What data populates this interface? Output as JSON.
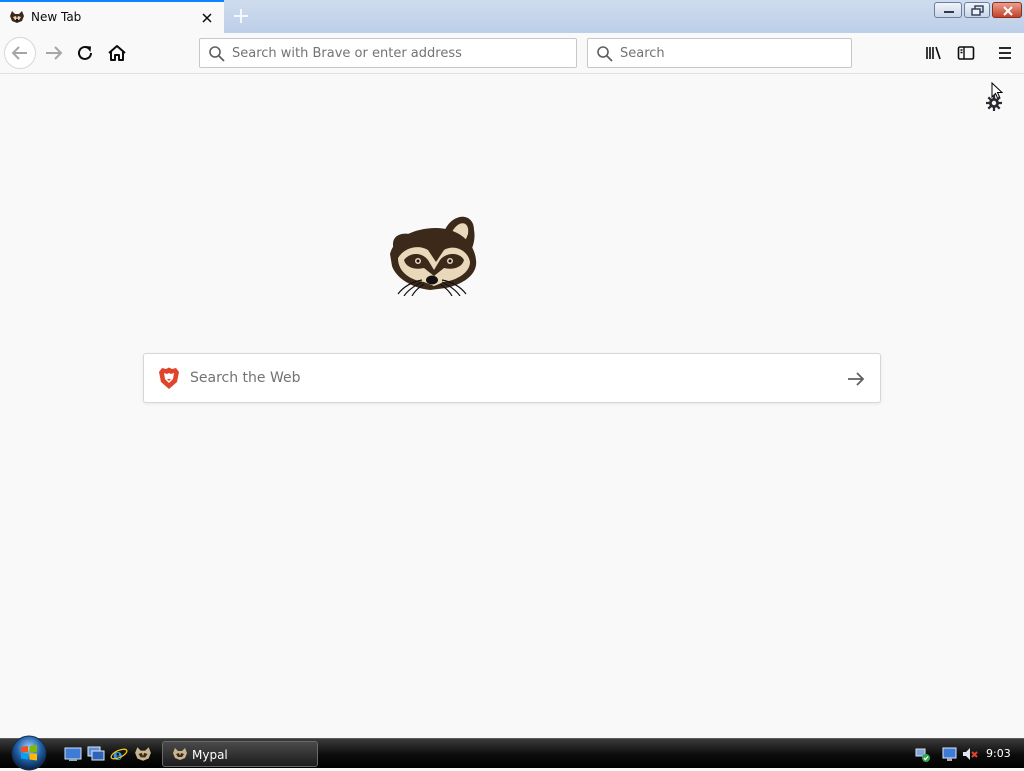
{
  "window": {
    "tab_title": "New Tab",
    "colors": {
      "accent": "#0a84ff",
      "titlebar": "#c6d6ec",
      "close_button": "#c3422a"
    }
  },
  "toolbar": {
    "address_placeholder": "Search with Brave or enter address",
    "search_placeholder": "Search"
  },
  "new_tab_page": {
    "search_placeholder": "Search the Web",
    "brand_color": "#e0452c"
  },
  "taskbar": {
    "task_label": "Mypal",
    "clock": "9:03",
    "icons": [
      "start-orb",
      "show-desktop-icon",
      "switch-windows-icon",
      "internet-explorer-icon",
      "mypal-quicklaunch-icon",
      "network-icon",
      "monitor-icon",
      "volume-muted-icon"
    ]
  }
}
